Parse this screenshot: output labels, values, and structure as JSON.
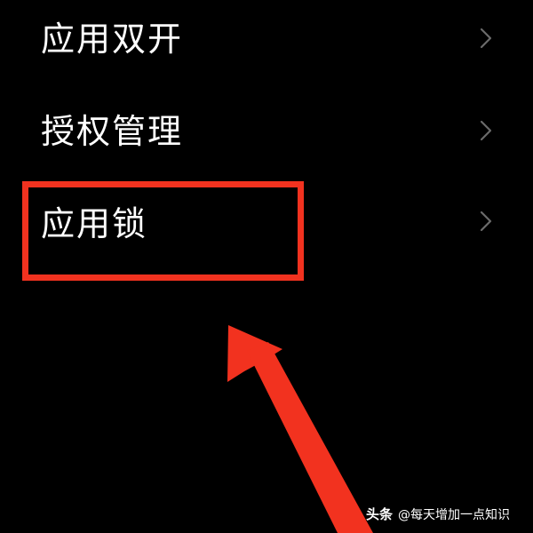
{
  "settings": {
    "items": [
      {
        "label": "应用双开",
        "icon": "chevron-right-icon"
      },
      {
        "label": "授权管理",
        "icon": "chevron-right-icon"
      },
      {
        "label": "应用锁",
        "icon": "chevron-right-icon"
      }
    ]
  },
  "annotation": {
    "highlight_color": "#f2321f",
    "arrow_color": "#f2321f"
  },
  "watermark": {
    "brand": "头条",
    "account": "@每天增加一点知识"
  },
  "colors": {
    "background": "#000000",
    "text": "#ffffff",
    "chevron": "#6b6b6b"
  }
}
